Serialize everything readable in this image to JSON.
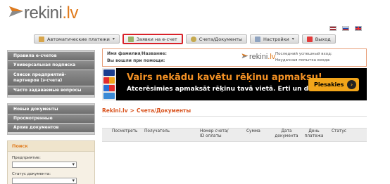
{
  "header": {
    "logo_text": "rekini",
    "logo_dot": ".lv",
    "icons": [
      "logo-envelope-icon",
      "flag-lv-icon",
      "flag-ru-icon",
      "flag-en-icon"
    ]
  },
  "nav": {
    "tabs": [
      {
        "label": "Автоматические платежи",
        "icon": "auto-pay-icon",
        "chevron": "▾"
      },
      {
        "label": "Заявки на е-счет",
        "icon": "edit-icon",
        "active": true
      },
      {
        "label": "Счета/Документы",
        "icon": "documents-icon"
      },
      {
        "label": "Настройки",
        "icon": "settings-icon",
        "chevron": "▾"
      },
      {
        "label": "Выход",
        "icon": "exit-icon"
      }
    ]
  },
  "sidebar": {
    "group1": [
      "Правила е-счетов",
      "Универсальная подписка",
      "Список предприятий-партнеров (э-счета)",
      "Часто задаваемые вопросы"
    ],
    "group2": [
      "Новые документы",
      "Просмотренные",
      "Архив документов"
    ],
    "search": {
      "title": "Поиск",
      "company_label": "Предприятие:",
      "status_label": "Статус документа:"
    }
  },
  "info": {
    "name_label": "Имя фамилия/Название:",
    "login_label": "Вы вошли при помощи:",
    "last_login": "Последний успешный вход:",
    "failed_login": "Неудачная попытка входа:"
  },
  "banner": {
    "headline": "Vairs nekādu kavētu rēķinu apmaksu!",
    "subline": "Atcerēsimies apmaksāt rēķinu tavā vietā. Erti un droši!",
    "button": "Piesakies"
  },
  "breadcrumb": {
    "root": "Rekini.lv",
    "sep": ">",
    "current": "Счета/Документы"
  },
  "table": {
    "columns": [
      "Посмотреть",
      "Получатель",
      "Номер счета/\nID оплаты",
      "Сумма",
      "Дата\nдокумента",
      "День\nплатежа",
      "Статус"
    ]
  },
  "colors": {
    "accent": "#e07b1d",
    "active_border": "#d9222a",
    "sidebar_item": "#7a7a7a",
    "banner_orange": "#f29024"
  }
}
